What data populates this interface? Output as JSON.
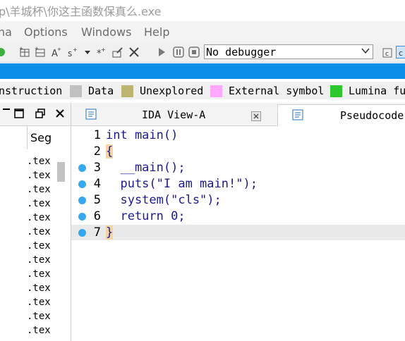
{
  "window": {
    "title": "p\\羊城杯\\你这主函数保真么.exe"
  },
  "menu": [
    "na",
    "Options",
    "Windows",
    "Help"
  ],
  "toolbar": {
    "debugger_value": "No debugger"
  },
  "legend": [
    {
      "label": "nstruction",
      "color": ""
    },
    {
      "label": "Data",
      "color": "#c0c0c0"
    },
    {
      "label": "Unexplored",
      "color": "#bcb572"
    },
    {
      "label": "External symbol",
      "color": "#ffa8ff"
    },
    {
      "label": "Lumina fu",
      "color": "#2ec72e"
    }
  ],
  "left_panel": {
    "column_header": "Seg",
    "rows": [
      ".tex",
      ".tex",
      ".tex",
      ".tex",
      ".tex",
      ".tex",
      ".tex",
      ".tex",
      ".tex",
      ".tex",
      ".tex",
      ".tex",
      ".tex"
    ]
  },
  "tabs": [
    {
      "label": "IDA View-A",
      "active": false
    },
    {
      "label": "Pseudocode",
      "active": true
    }
  ],
  "code_lines": [
    {
      "num": "1",
      "text": "int main()",
      "bp": false
    },
    {
      "num": "2",
      "text": "{",
      "bp": false
    },
    {
      "num": "3",
      "text": "  __main();",
      "bp": true
    },
    {
      "num": "4",
      "text": "  puts(\"I am main!\");",
      "bp": true
    },
    {
      "num": "5",
      "text": "  system(\"cls\");",
      "bp": true
    },
    {
      "num": "6",
      "text": "  return 0;",
      "bp": true
    },
    {
      "num": "7",
      "text": "}",
      "bp": true
    }
  ]
}
